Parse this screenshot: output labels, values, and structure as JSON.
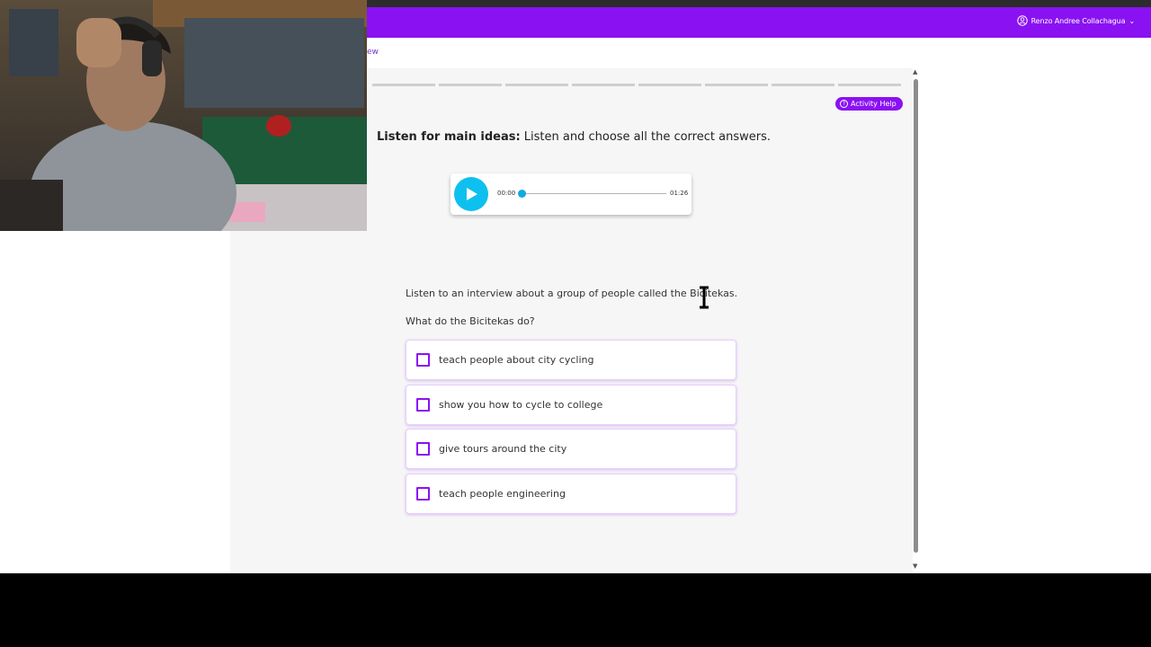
{
  "header": {
    "user_name": "Renzo Andree Collachagua",
    "icons": {
      "user": "user-circle-icon",
      "chevron": "chevron-down-icon"
    },
    "color": "#8a12f2"
  },
  "breadcrumb_fragment": "ew",
  "activity": {
    "help_label": "Activity Help",
    "instruction_bold": "Listen for main ideas:",
    "instruction_text": " Listen and choose all the correct answers.",
    "progress_segments": 8
  },
  "audio": {
    "current_time": "00:00",
    "duration": "01:26",
    "progress": 0,
    "accent": "#0ec0ef"
  },
  "question": {
    "intro": "Listen to an interview about a group of people called the Bicitekas.",
    "text": "What do the Bicitekas do?",
    "options": [
      {
        "label": "teach people about city cycling",
        "checked": false
      },
      {
        "label": "show you how to cycle to college",
        "checked": false
      },
      {
        "label": "give tours around the city",
        "checked": false
      },
      {
        "label": "teach people engineering",
        "checked": false
      }
    ]
  }
}
